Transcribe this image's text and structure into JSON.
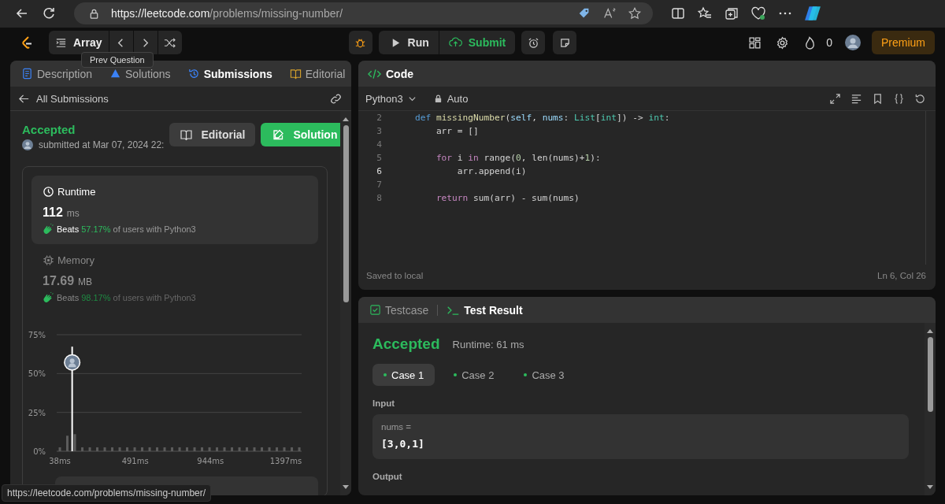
{
  "browser": {
    "url_origin": "https://leetcode.com",
    "url_path": "/problems/missing-number/"
  },
  "toolbar": {
    "problem_list": "Array",
    "run": "Run",
    "submit": "Submit",
    "streak": "0",
    "premium": "Premium"
  },
  "tooltip": "Prev Question",
  "left_tabs": [
    {
      "label": "Description",
      "kind": "description",
      "selected": false
    },
    {
      "label": "Solutions",
      "kind": "solutions",
      "selected": false
    },
    {
      "label": "Submissions",
      "kind": "submissions",
      "selected": true
    },
    {
      "label": "Editorial",
      "kind": "editorial",
      "selected": false
    }
  ],
  "back_link": "All Submissions",
  "submission": {
    "status": "Accepted",
    "submitted": "submitted at Mar 07, 2024 22:",
    "editorial_button": "Editorial",
    "solution_button": "Solution"
  },
  "stats": [
    {
      "kind": "runtime",
      "title": "Runtime",
      "value": "112",
      "unit": "ms",
      "beats": "Beats",
      "percent": "57.17%",
      "suffix": "of users with Python3",
      "selected": true
    },
    {
      "kind": "memory",
      "title": "Memory",
      "value": "17.69",
      "unit": "MB",
      "beats": "Beats",
      "percent": "98.17%",
      "suffix": "of users with Python3",
      "selected": false
    }
  ],
  "chart_data": {
    "type": "bar",
    "x": [
      38,
      83,
      128,
      173,
      218,
      263,
      308,
      353,
      398,
      443,
      488,
      533,
      578,
      623,
      668,
      713,
      758,
      803,
      848,
      893,
      938,
      983,
      1028,
      1073,
      1118,
      1163,
      1208,
      1253,
      1298,
      1343,
      1388,
      1433,
      1478
    ],
    "values": [
      2.5,
      10,
      11,
      2.5,
      2.5,
      2.5,
      2.5,
      2.5,
      2.5,
      2.5,
      2.5,
      2.5,
      2.5,
      2.5,
      2.5,
      2.5,
      2.5,
      2.5,
      2.5,
      2.5,
      2.5,
      2.5,
      2.5,
      2.5,
      2.5,
      2.5,
      2.5,
      2.5,
      2.5,
      2.5,
      2.5,
      2.5,
      2.5
    ],
    "xlim": [
      19,
      1492
    ],
    "ylim": [
      0,
      75
    ],
    "xticks": [
      {
        "value": 38,
        "label": "38ms"
      },
      {
        "value": 491,
        "label": "491ms"
      },
      {
        "value": 944,
        "label": "944ms"
      },
      {
        "value": 1397,
        "label": "1397ms"
      }
    ],
    "yticks": [
      {
        "value": 0,
        "label": "0%"
      },
      {
        "value": 25,
        "label": "25%"
      },
      {
        "value": 50,
        "label": "50%"
      },
      {
        "value": 75,
        "label": "75%"
      }
    ],
    "ref_lines": [
      {
        "axis": "x",
        "value": 112
      }
    ]
  },
  "code": {
    "title": "Code",
    "language": "Python3",
    "mode": "Auto",
    "lines": [
      {
        "number": "2",
        "active": false,
        "tokens": [
          {
            "text": "    def",
            "kind": "storage"
          },
          {
            "text": " missingNumber",
            "kind": "function"
          },
          {
            "text": "(",
            "kind": "plain"
          },
          {
            "text": "self",
            "kind": "variable"
          },
          {
            "text": ", ",
            "kind": "plain"
          },
          {
            "text": "nums",
            "kind": "variable"
          },
          {
            "text": ": ",
            "kind": "plain"
          },
          {
            "text": "List",
            "kind": "type"
          },
          {
            "text": "[",
            "kind": "plain"
          },
          {
            "text": "int",
            "kind": "type"
          },
          {
            "text": "]) -> ",
            "kind": "plain"
          },
          {
            "text": "int",
            "kind": "type"
          },
          {
            "text": ":",
            "kind": "plain"
          }
        ]
      },
      {
        "number": "3",
        "active": false,
        "tokens": [
          {
            "text": "        arr = []",
            "kind": "plain"
          }
        ]
      },
      {
        "number": "4",
        "active": false
      },
      {
        "number": "5",
        "active": false,
        "tokens": [
          {
            "text": "        for",
            "kind": "keyword"
          },
          {
            "text": " i ",
            "kind": "plain"
          },
          {
            "text": "in",
            "kind": "keyword"
          },
          {
            "text": " range(",
            "kind": "plain"
          },
          {
            "text": "0",
            "kind": "number"
          },
          {
            "text": ", len(nums)+",
            "kind": "plain"
          },
          {
            "text": "1",
            "kind": "number"
          },
          {
            "text": "):",
            "kind": "plain"
          }
        ]
      },
      {
        "number": "6",
        "active": true,
        "tokens": [
          {
            "text": "            arr.append(i)",
            "kind": "plain"
          }
        ]
      },
      {
        "number": "7",
        "active": false
      },
      {
        "number": "8",
        "active": false,
        "tokens": [
          {
            "text": "        return",
            "kind": "keyword"
          },
          {
            "text": " sum(arr) - sum(nums)",
            "kind": "plain"
          }
        ]
      }
    ],
    "saved": "Saved to local",
    "cursor": "Ln 6, Col 26"
  },
  "test_tabs": [
    {
      "label": "Testcase",
      "kind": "testcase",
      "selected": false
    },
    {
      "label": "Test Result",
      "kind": "result",
      "selected": true
    }
  ],
  "result": {
    "status": "Accepted",
    "runtime": "Runtime: 61 ms",
    "cases": [
      {
        "label": "Case 1",
        "selected": true
      },
      {
        "label": "Case 2",
        "selected": false
      },
      {
        "label": "Case 3",
        "selected": false
      }
    ],
    "input_label": "Input",
    "input_name": "nums =",
    "input_value": "[3,0,1]",
    "output_label": "Output"
  },
  "status_url": "https://leetcode.com/problems/missing-number/"
}
